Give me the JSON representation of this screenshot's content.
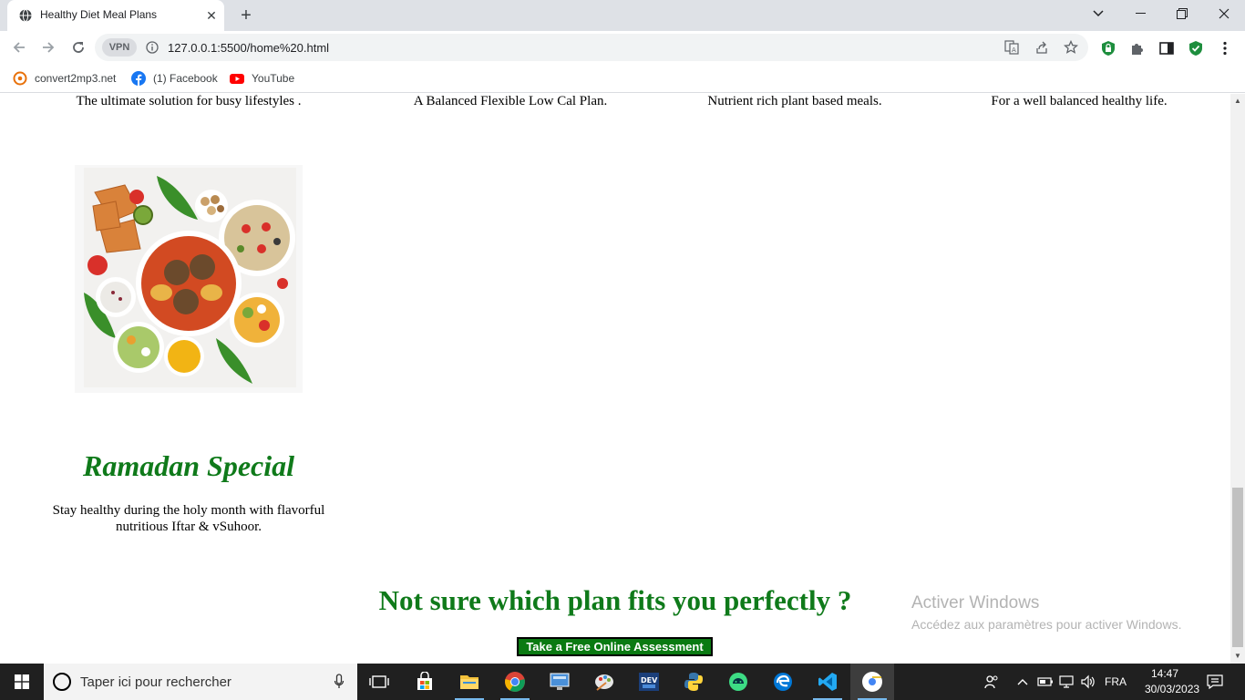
{
  "browser": {
    "tab_title": "Healthy Diet Meal Plans",
    "vpn_label": "VPN",
    "url": "127.0.0.1:5500/home%20.html",
    "bookmarks": [
      {
        "label": "convert2mp3.net",
        "icon": "convert2mp3-icon"
      },
      {
        "label": "(1) Facebook",
        "icon": "facebook-icon"
      },
      {
        "label": "YouTube",
        "icon": "youtube-icon"
      }
    ]
  },
  "page": {
    "plan_descriptions": [
      "The ultimate solution for busy lifestyles .",
      "A Balanced Flexible Low Cal Plan.",
      "Nutrient rich plant based meals.",
      "For a well balanced healthy life."
    ],
    "ramadan": {
      "title": "Ramadan Special",
      "description": "Stay healthy during the holy month with flavorful nutritious Iftar & vSuhoor."
    },
    "cta": {
      "heading": "Not sure which plan fits you perfectly ?",
      "button_label": "Take a Free Online Assessment"
    },
    "watermark": {
      "title": "Activer Windows",
      "subtitle": "Accédez aux paramètres pour activer Windows."
    },
    "colors": {
      "accent_green": "#0f7a1a"
    }
  },
  "taskbar": {
    "search_placeholder": "Taper ici pour rechercher",
    "language": "FRA",
    "time": "14:47",
    "date": "30/03/2023"
  }
}
